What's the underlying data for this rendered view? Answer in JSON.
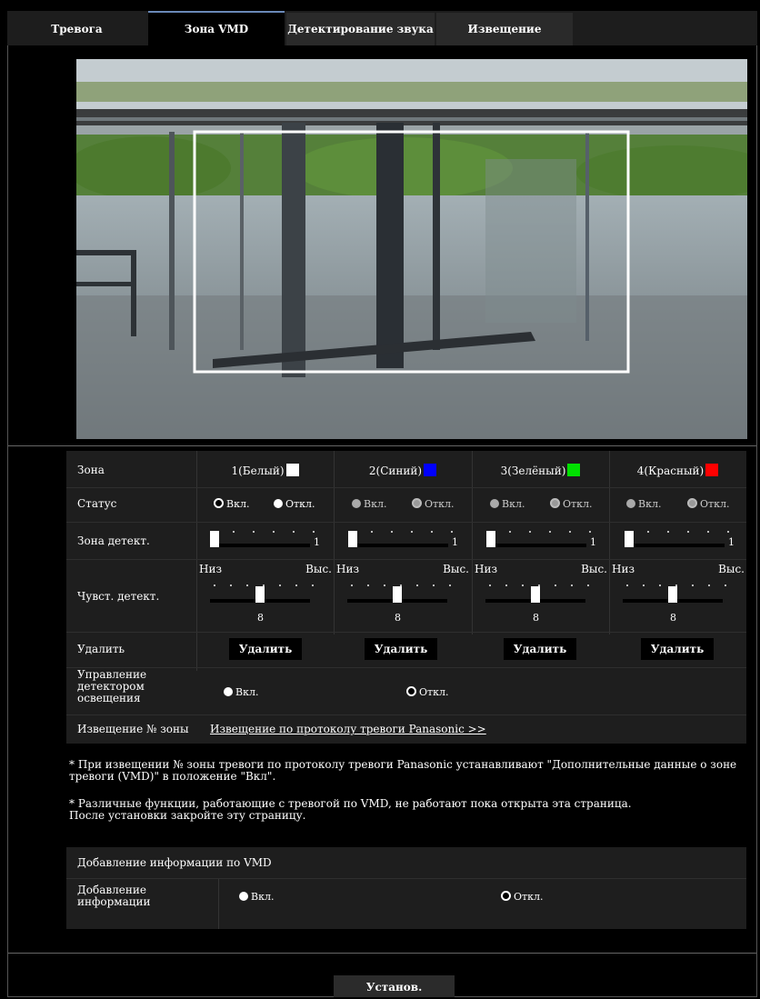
{
  "tabs": [
    "Тревога",
    "Зона VMD",
    "Детектирование звука",
    "Извещение"
  ],
  "zones": {
    "label": "Зона",
    "items": [
      {
        "name": "1(Белый)",
        "color": "#ffffff"
      },
      {
        "name": "2(Синий)",
        "color": "#0000ff"
      },
      {
        "name": "3(Зелёный)",
        "color": "#00e000"
      },
      {
        "name": "4(Красный)",
        "color": "#ff0000"
      }
    ]
  },
  "status": {
    "label": "Статус",
    "on": "Вкл.",
    "off": "Откл.",
    "selected": [
      "on",
      "off",
      "off",
      "off"
    ]
  },
  "detect_area": {
    "label": "Зона детект.",
    "values": [
      "1",
      "1",
      "1",
      "1"
    ]
  },
  "sensitivity": {
    "label": "Чувст. детект.",
    "low": "Низ",
    "high": "Выс.",
    "values": [
      "8",
      "8",
      "8",
      "8"
    ]
  },
  "delete": {
    "label": "Удалить",
    "button": "Удалить"
  },
  "light_control": {
    "label": "Управление детектором освещения",
    "on": "Вкл.",
    "off": "Откл.",
    "selected": "off"
  },
  "notify_zone": {
    "label": "Извещение № зоны",
    "link": "Извещение по протоколу тревоги Panasonic >>"
  },
  "notes": [
    "* При извещении № зоны тревоги по протоколу тревоги Panasonic устанавливают \"Дополнительные данные о зоне тревоги (VMD)\" в положение \"Вкл\".",
    "* Различные функции, работающие с тревогой по VMD, не работают пока открыта эта страница.",
    "После установки закройте эту страницу."
  ],
  "vmd_info": {
    "header": "Добавление информации по VMD",
    "label": "Добавление информации",
    "on": "Вкл.",
    "off": "Откл.",
    "selected": "off"
  },
  "set_button": "Установ."
}
